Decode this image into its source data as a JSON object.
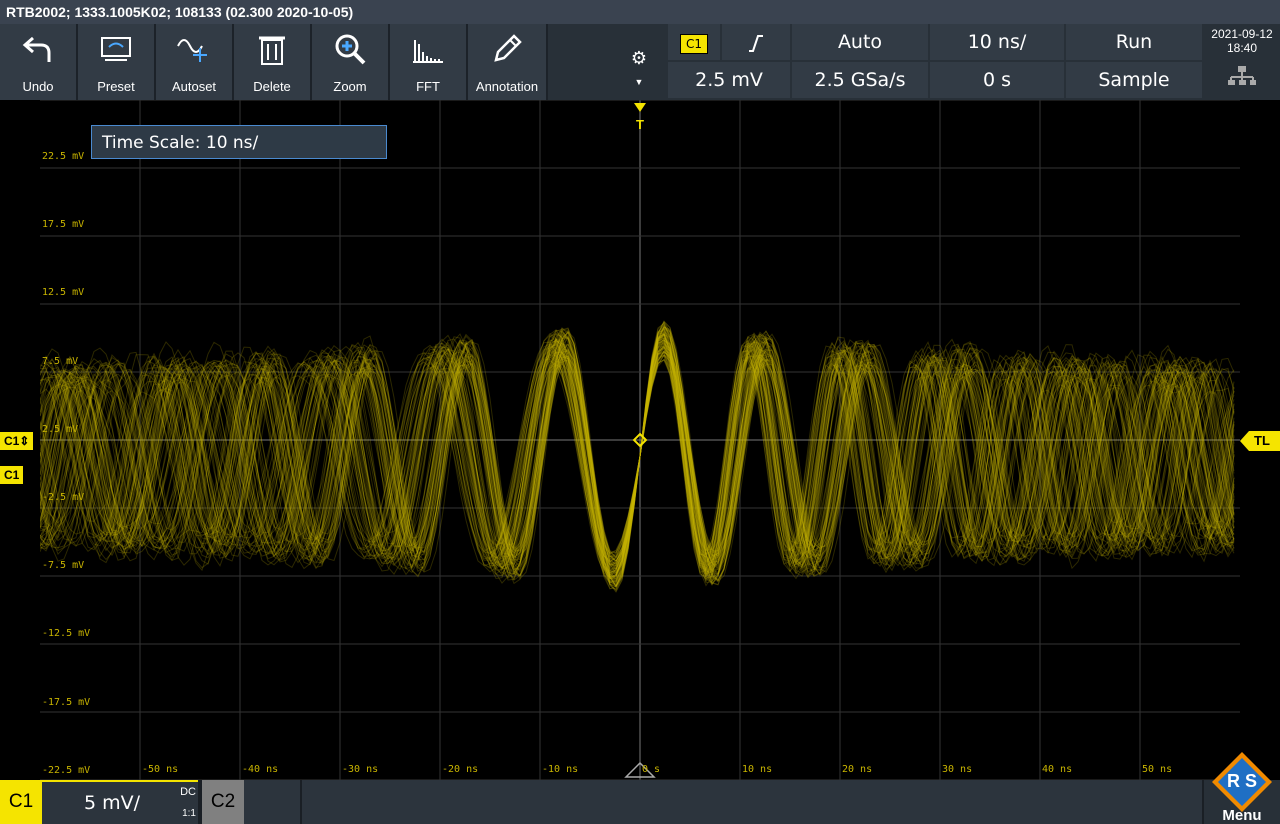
{
  "title": "RTB2002; 1333.1005K02; 108133 (02.300 2020-10-05)",
  "toolbar": {
    "undo": "Undo",
    "preset": "Preset",
    "autoset": "Autoset",
    "delete": "Delete",
    "zoom": "Zoom",
    "fft": "FFT",
    "annotation": "Annotation"
  },
  "trigger": {
    "source": "C1",
    "slope_icon": "rising-edge-icon",
    "mode": "Auto",
    "time_scale": "10 ns/",
    "state": "Run",
    "level": "2.5 mV",
    "sample_rate": "2.5 GSa/s",
    "offset": "0 s",
    "acquisition": "Sample"
  },
  "datetime": {
    "date": "2021-09-12",
    "time": "18:40"
  },
  "tooltip": "Time Scale: 10 ns/",
  "y_labels": [
    "22.5 mV",
    "17.5 mV",
    "12.5 mV",
    "7.5 mV",
    "2.5 mV",
    "-2.5 mV",
    "-7.5 mV",
    "-12.5 mV",
    "-17.5 mV",
    "-22.5 mV"
  ],
  "x_labels": [
    "-50 ns",
    "-40 ns",
    "-30 ns",
    "-20 ns",
    "-10 ns",
    "0 s",
    "10 ns",
    "20 ns",
    "30 ns",
    "40 ns",
    "50 ns"
  ],
  "left_markers": {
    "c1_level": "C1",
    "c1": "C1"
  },
  "right_marker": "TL",
  "trigger_marker": "T",
  "channel": {
    "c1_label": "C1",
    "scale": "5 mV/",
    "coupling": "DC",
    "probe": "1:1",
    "c2_label": "C2"
  },
  "menu_label": "Menu",
  "colors": {
    "trace": "#c8b400",
    "accent": "#f5e400",
    "panel": "#323b45"
  },
  "chart_data": {
    "type": "line",
    "xlabel": "",
    "ylabel": "",
    "xlim": [
      -60,
      60
    ],
    "ylim": [
      -25,
      25
    ],
    "x_unit": "ns",
    "y_unit": "mV",
    "frequency_mhz": 100,
    "trigger_level_mv": 2.5,
    "amplitude_peak_mv": 8.5,
    "grid": true
  }
}
